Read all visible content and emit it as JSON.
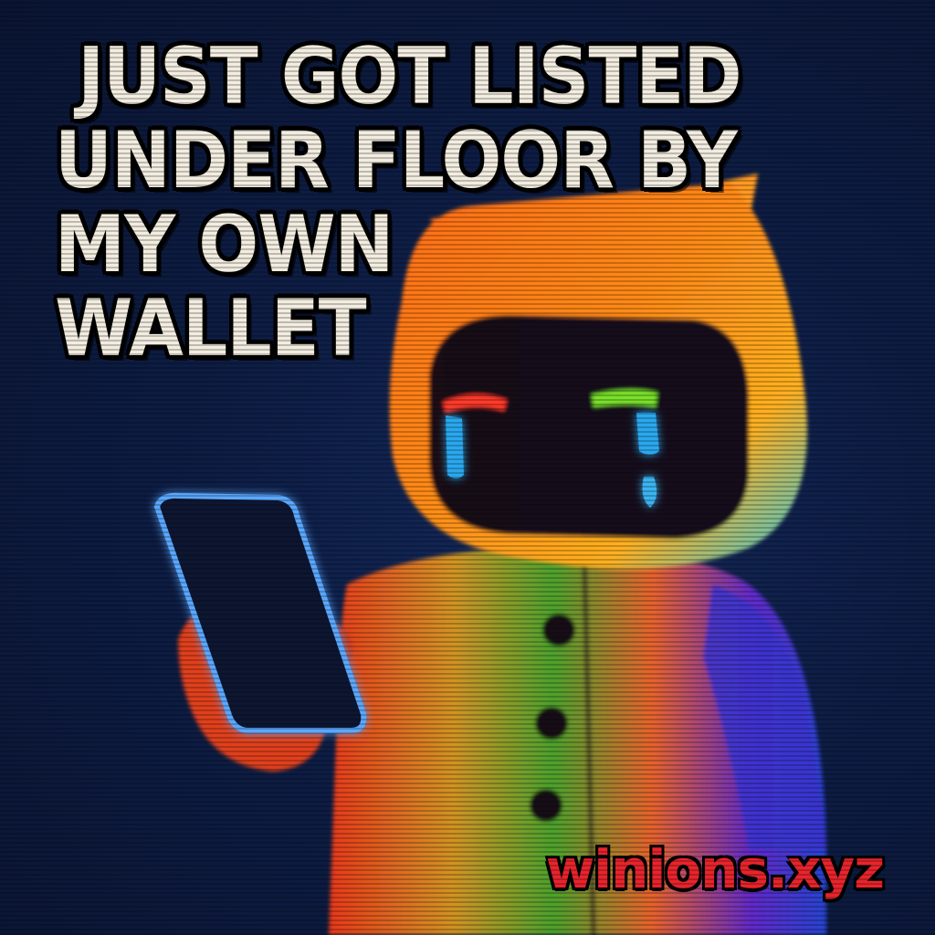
{
  "headline": {
    "line1": "JUST GOT LISTED",
    "line2": "UNDER FLOOR BY",
    "line3": "MY OWN",
    "line4": "WALLET"
  },
  "brand": "winions.xyz",
  "colors": {
    "background": "#0c1a3a",
    "headline_fill": "#f2ede0",
    "brand_red": "#e8242c",
    "phone_glow": "#5aa8ff",
    "tear_blue": "#3aa8e8"
  },
  "icons": [
    "crying-cat-character",
    "smartphone-icon",
    "tear-drop-icon"
  ]
}
